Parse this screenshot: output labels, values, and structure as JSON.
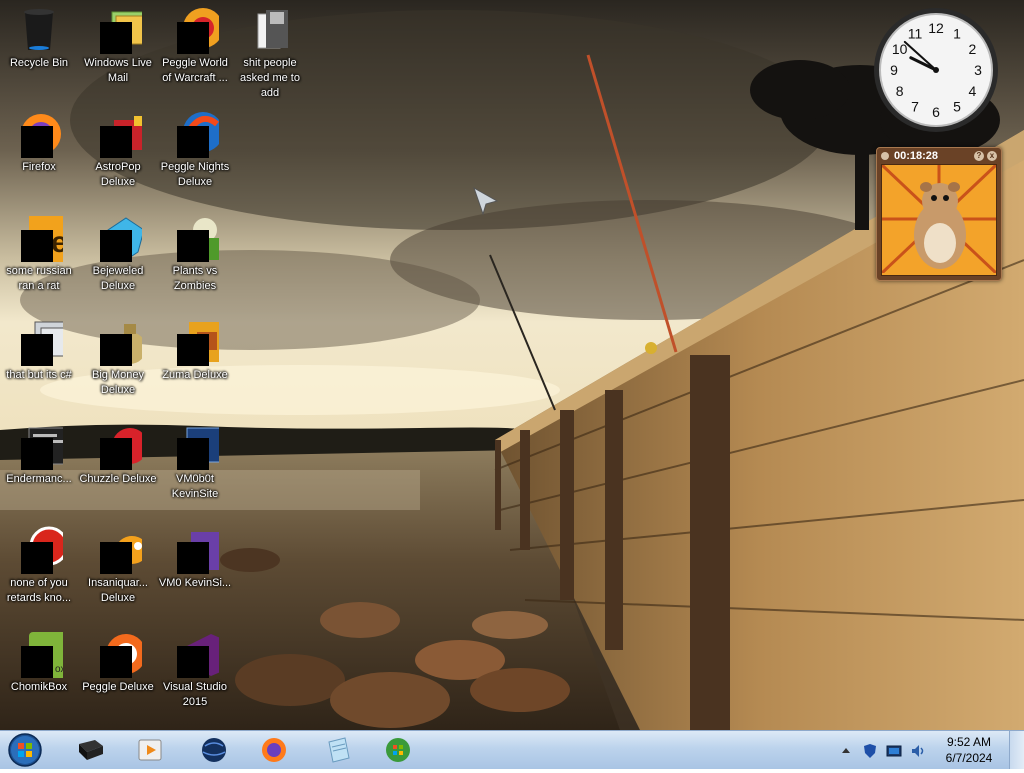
{
  "desktop": {
    "icons": [
      {
        "label": "Recycle Bin"
      },
      {
        "label": "Windows Live Mail"
      },
      {
        "label": "Peggle World of Warcraft ..."
      },
      {
        "label": "shit people asked me to add"
      },
      {
        "label": "Firefox"
      },
      {
        "label": "AstroPop Deluxe"
      },
      {
        "label": "Peggle Nights Deluxe"
      },
      {
        "label": "some russian ran a rat"
      },
      {
        "label": "Bejeweled Deluxe"
      },
      {
        "label": "Plants vs Zombies"
      },
      {
        "label": "that but its c#"
      },
      {
        "label": "Big Money Deluxe"
      },
      {
        "label": "Zuma Deluxe"
      },
      {
        "label": "Endermanc..."
      },
      {
        "label": "Chuzzle Deluxe"
      },
      {
        "label": "VM0b0t KevinSite"
      },
      {
        "label": "none of you retards kno..."
      },
      {
        "label": "Insaniquar... Deluxe"
      },
      {
        "label": "VM0 KevinSi..."
      },
      {
        "label": "ChomikBox"
      },
      {
        "label": "Peggle Deluxe"
      },
      {
        "label": "Visual Studio 2015"
      }
    ]
  },
  "clock_gadget": {
    "numerals": [
      "12",
      "1",
      "2",
      "3",
      "4",
      "5",
      "6",
      "7",
      "8",
      "9",
      "10",
      "11"
    ],
    "hour": 9,
    "minute": 52
  },
  "timer_gadget": {
    "elapsed": "00:18:28",
    "help_label": "?",
    "close_label": "x"
  },
  "taskbar": {
    "pinned": [
      {
        "icon": "terminal-icon"
      },
      {
        "icon": "media-player-icon"
      },
      {
        "icon": "globe-icon"
      },
      {
        "icon": "firefox-icon"
      },
      {
        "icon": "notepad-icon"
      },
      {
        "icon": "windows-update-icon"
      }
    ],
    "tray": {
      "time": "9:52 AM",
      "date": "6/7/2024"
    }
  },
  "colors": {
    "taskbar_top": "#dde9f6",
    "taskbar_bottom": "#a9c4e4",
    "timer_frame": "#6a4226",
    "timer_bg": "#f3a32a"
  }
}
